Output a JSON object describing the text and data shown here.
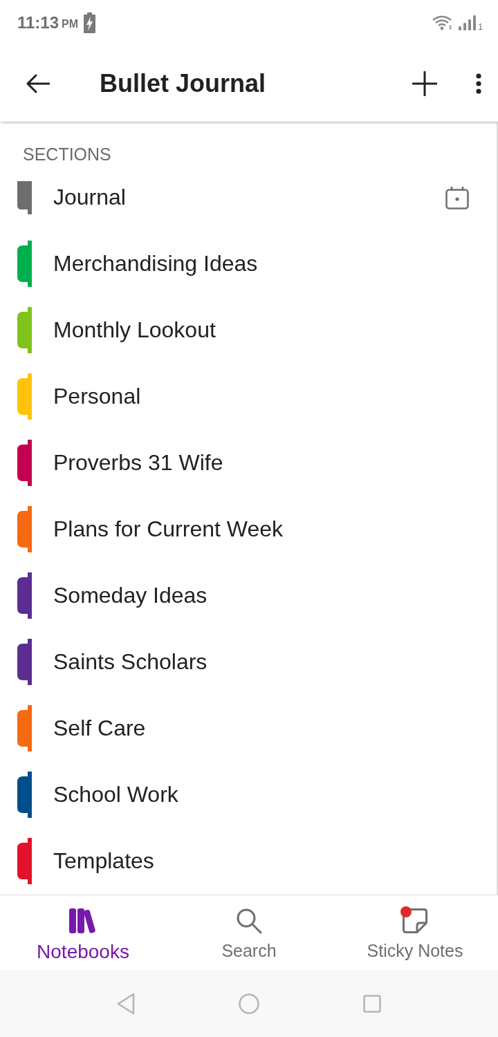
{
  "status_bar": {
    "time": "11:13",
    "meridiem": "PM",
    "sim_label": "1"
  },
  "app_bar": {
    "title": "Bullet Journal"
  },
  "sections_header": "SECTIONS",
  "sections": [
    {
      "name": "Journal",
      "color": "#6e6e6e",
      "kind": "dated"
    },
    {
      "name": "Merchandising Ideas",
      "color": "#00b04f",
      "kind": "plain"
    },
    {
      "name": "Monthly Lookout",
      "color": "#7fc31c",
      "kind": "plain"
    },
    {
      "name": "Personal",
      "color": "#ffc30d",
      "kind": "plain"
    },
    {
      "name": "Proverbs 31 Wife",
      "color": "#c2004f",
      "kind": "plain"
    },
    {
      "name": "Plans for Current Week",
      "color": "#f56a12",
      "kind": "plain"
    },
    {
      "name": "Someday Ideas",
      "color": "#5c2d91",
      "kind": "plain"
    },
    {
      "name": "Saints Scholars",
      "color": "#5c2d91",
      "kind": "plain"
    },
    {
      "name": "Self Care",
      "color": "#f56a12",
      "kind": "plain"
    },
    {
      "name": "School Work",
      "color": "#004e8c",
      "kind": "plain"
    },
    {
      "name": "Templates",
      "color": "#e3122b",
      "kind": "plain"
    }
  ],
  "bottom_nav": [
    {
      "label": "Notebooks",
      "kind": "notebooks",
      "selected": true,
      "notification": false
    },
    {
      "label": "Search",
      "kind": "search",
      "selected": false,
      "notification": false
    },
    {
      "label": "Sticky Notes",
      "kind": "sticky",
      "selected": false,
      "notification": true
    }
  ]
}
